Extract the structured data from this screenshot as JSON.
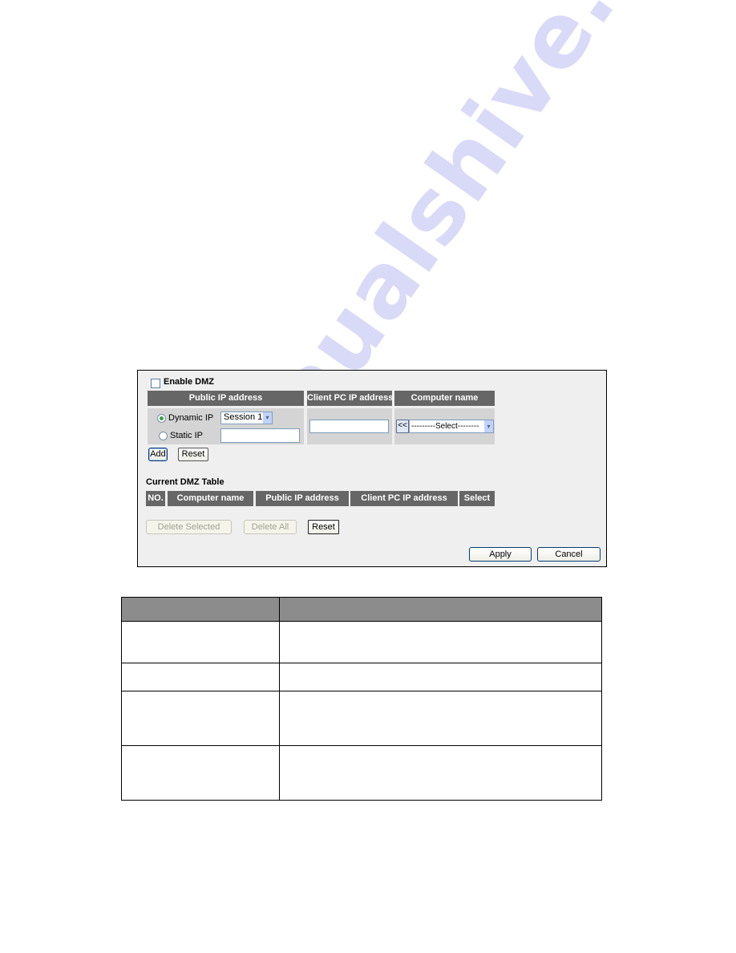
{
  "dmz_panel": {
    "enable_label": "Enable DMZ",
    "enable_checked": false,
    "headers": {
      "public_ip": "Public IP address",
      "client_pc_ip": "Client PC IP address",
      "computer_name": "Computer name"
    },
    "dynamic_ip_label": "Dynamic IP",
    "dynamic_ip_selected": true,
    "session_select_value": "Session 1",
    "static_ip_label": "Static IP",
    "static_ip_value": "",
    "client_pc_ip_value": "",
    "copy_button_label": "<<",
    "computer_select_value": "---------Select--------",
    "add_label": "Add",
    "reset_label": "Reset"
  },
  "current_table": {
    "title": "Current DMZ Table",
    "columns": [
      "NO.",
      "Computer name",
      "Public IP address",
      "Client PC IP address",
      "Select"
    ],
    "rows": []
  },
  "table_actions": {
    "delete_selected_label": "Delete Selected",
    "delete_all_label": "Delete All",
    "reset_label": "Reset"
  },
  "footer": {
    "apply_label": "Apply",
    "cancel_label": "Cancel"
  },
  "doc_table": {
    "header": [
      "",
      ""
    ],
    "rows": [
      [
        "",
        ""
      ],
      [
        "",
        ""
      ],
      [
        "",
        ""
      ],
      [
        "",
        ""
      ]
    ]
  },
  "watermark": "manualshive.com",
  "icons": {
    "dropdown_arrow": "▾"
  }
}
